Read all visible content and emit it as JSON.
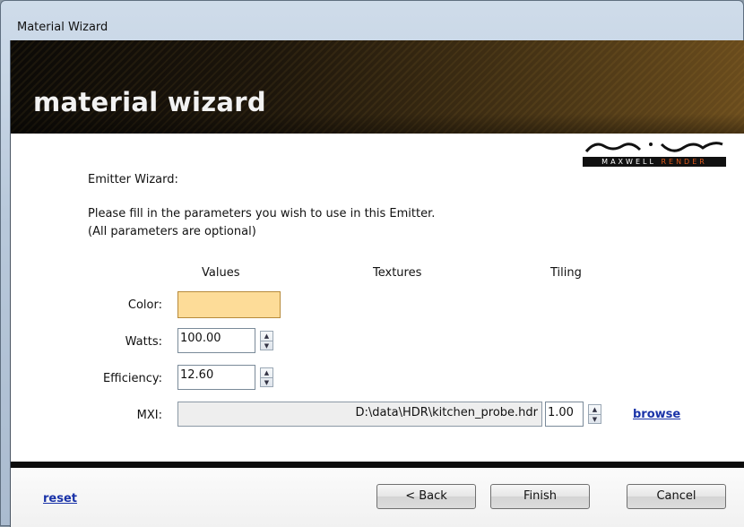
{
  "window": {
    "title": "Material Wizard"
  },
  "banner": {
    "title": "material wizard"
  },
  "logo": {
    "word1": "MAXWELL",
    "word2": "RENDER"
  },
  "intro": {
    "heading": "Emitter Wizard:",
    "line1": "Please fill in the parameters you wish to use in this Emitter.",
    "line2": "(All parameters are optional)"
  },
  "columns": {
    "values": "Values",
    "textures": "Textures",
    "tiling": "Tiling"
  },
  "fields": {
    "color": {
      "label": "Color:",
      "swatch": "#fddc98"
    },
    "watts": {
      "label": "Watts:",
      "value": "100.00"
    },
    "efficiency": {
      "label": "Efficiency:",
      "value": "12.60"
    },
    "mxi": {
      "label": "MXI:",
      "path": "D:\\data\\HDR\\kitchen_probe.hdr",
      "tiling": "1.00",
      "browse": "browse"
    }
  },
  "footer": {
    "reset": "reset",
    "back": "< Back",
    "finish": "Finish",
    "cancel": "Cancel"
  }
}
